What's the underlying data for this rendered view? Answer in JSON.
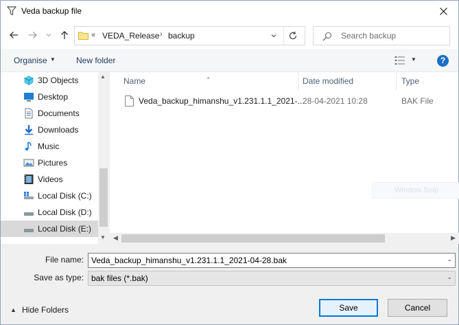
{
  "window": {
    "title": "Veda backup file",
    "close_glyph": "✕"
  },
  "nav": {
    "back_glyph": "←",
    "forward_glyph": "→",
    "recent_glyph": "⌄",
    "up_glyph": "↑",
    "breadcrumb_overflow": "«",
    "breadcrumb": [
      "VEDA_Release",
      "backup"
    ],
    "breadcrumb_sep": "›",
    "search_placeholder": "Search backup"
  },
  "toolbar": {
    "organise_label": "Organise",
    "new_folder_label": "New folder",
    "help_label": "?"
  },
  "sidebar": {
    "items": [
      {
        "label": "3D Objects",
        "icon": "3d-objects-icon",
        "selected": false
      },
      {
        "label": "Desktop",
        "icon": "desktop-icon",
        "selected": false
      },
      {
        "label": "Documents",
        "icon": "documents-icon",
        "selected": false
      },
      {
        "label": "Downloads",
        "icon": "downloads-icon",
        "selected": false
      },
      {
        "label": "Music",
        "icon": "music-icon",
        "selected": false
      },
      {
        "label": "Pictures",
        "icon": "pictures-icon",
        "selected": false
      },
      {
        "label": "Videos",
        "icon": "videos-icon",
        "selected": false
      },
      {
        "label": "Local Disk (C:)",
        "icon": "drive-c-icon",
        "selected": false
      },
      {
        "label": "Local Disk (D:)",
        "icon": "drive-d-icon",
        "selected": false
      },
      {
        "label": "Local Disk (E:)",
        "icon": "drive-e-icon",
        "selected": true
      }
    ]
  },
  "file_list": {
    "columns": [
      "Name",
      "Date modified",
      "Type"
    ],
    "rows": [
      {
        "name": "Veda_backup_himanshu_v1.231.1.1_2021-...",
        "date_modified": "28-04-2021 10:28",
        "type": "BAK File"
      }
    ],
    "overlay_text": "Window Snip"
  },
  "form": {
    "file_name_label": "File name:",
    "file_name_value": "Veda_backup_himanshu_v1.231.1.1_2021-04-28.bak",
    "save_as_type_label": "Save as type:",
    "save_as_type_value": "bak files (*.bak)",
    "hide_folders_label": "Hide Folders",
    "save_button": "Save",
    "cancel_button": "Cancel"
  },
  "colors": {
    "accent": "#0078d7",
    "help_icon": "#1a6fc6",
    "selected_row": "#d9d9d9"
  }
}
